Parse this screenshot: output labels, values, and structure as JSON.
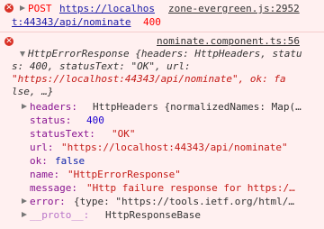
{
  "log": [
    {
      "method": "POST",
      "url_part1": "https://localhos",
      "source": "zone-evergreen.js:2952",
      "url_part2": "t:44343/api/nominate",
      "status_code": "400"
    },
    {
      "source": "nominate.component.ts:56",
      "summary_lines": [
        "HttpErrorResponse {headers: HttpHeaders, statu",
        "s: 400, statusText: \"OK\", url:",
        "\"https://localhost:44343/api/nominate\", ok: fa",
        "lse, …}"
      ],
      "props": [
        {
          "key": "headers",
          "value": "HttpHeaders {normalizedNames: Map(…"
        },
        {
          "key": "status",
          "value": "400"
        },
        {
          "key": "statusText",
          "value": "\"OK\""
        },
        {
          "key": "url",
          "value": "\"https://localhost:44343/api/nominate\""
        },
        {
          "key": "ok",
          "value": "false"
        },
        {
          "key": "name",
          "value": "\"HttpErrorResponse\""
        },
        {
          "key": "message",
          "value": "\"Http failure response for https:/…"
        },
        {
          "key": "error",
          "value": "{type: \"https://tools.ietf.org/html/…"
        },
        {
          "key": "__proto__",
          "value": "HttpResponseBase"
        }
      ]
    }
  ],
  "colors": {
    "background": "#fff0f0",
    "error_red": "#f00",
    "key_purple": "#881391",
    "number_blue": "#1c00cf",
    "string_red": "#c41a16"
  }
}
